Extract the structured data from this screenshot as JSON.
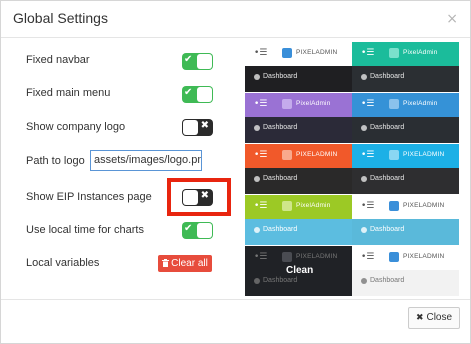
{
  "dialog": {
    "title": "Global Settings",
    "close_glyph": "×"
  },
  "settings": [
    {
      "label": "Fixed navbar",
      "state": "on"
    },
    {
      "label": "Fixed main menu",
      "state": "on"
    },
    {
      "label": "Show company logo",
      "state": "off"
    },
    {
      "label": "Path to logo",
      "value": "assets/images/logo.png"
    },
    {
      "label": "Show EIP Instances page",
      "state": "off",
      "highlighted": true
    },
    {
      "label": "Use local time for charts",
      "state": "on"
    },
    {
      "label": "Local variables",
      "button_label": "Clear all"
    }
  ],
  "toggle_glyphs": {
    "on": "✔",
    "off": "✖"
  },
  "icons": {
    "clear": "trash-icon",
    "close": "close-icon",
    "menu": "menu-icon",
    "dashboard": "dashboard-icon"
  },
  "themes": {
    "menu_glyph": "•☰",
    "dashboard_label": "Dashboard",
    "items": [
      {
        "name": "default",
        "top_bg": "#ffffff",
        "top_fg": "#555555",
        "bot_bg": "#1f1f22",
        "bot_fg": "#e6e6e6",
        "logo_bg": "#3a8fd9",
        "logo_text": "PIXELADMIN"
      },
      {
        "name": "mint",
        "top_bg": "#1bbc9b",
        "top_fg": "#ffffff",
        "bot_bg": "#2b2f33",
        "bot_fg": "#e6e6e6",
        "logo_bg": "#7ae0cc",
        "logo_text": "PixelAdmin"
      },
      {
        "name": "purple",
        "top_bg": "#9a72d4",
        "top_fg": "#ffffff",
        "bot_bg": "#2b2a38",
        "bot_fg": "#e6e6e6",
        "logo_bg": "#c4abec",
        "logo_text": "PixelAdmin"
      },
      {
        "name": "blue",
        "top_bg": "#3592d7",
        "top_fg": "#ffffff",
        "bot_bg": "#2a2e33",
        "bot_fg": "#e6e6e6",
        "logo_bg": "#8bc2ec",
        "logo_text": "PixelAdmin"
      },
      {
        "name": "orange",
        "top_bg": "#f1592a",
        "top_fg": "#ffffff",
        "bot_bg": "#2a2929",
        "bot_fg": "#e6e6e6",
        "logo_bg": "#f9a98d",
        "logo_text": "PIXELADMIN"
      },
      {
        "name": "sky",
        "top_bg": "#1cb0e6",
        "top_fg": "#ffffff",
        "bot_bg": "#2e2e30",
        "bot_fg": "#e6e6e6",
        "logo_bg": "#8ad7f3",
        "logo_text": "PIXELADMIN"
      },
      {
        "name": "lime",
        "top_bg": "#9cc925",
        "top_fg": "#ffffff",
        "bot_bg": "#5cbde0",
        "bot_fg": "#ffffff",
        "logo_bg": "#cfe68a",
        "logo_text": "PixelAdmin"
      },
      {
        "name": "cyan",
        "top_bg": "#ffffff",
        "top_fg": "#555555",
        "bot_bg": "#5ab9da",
        "bot_fg": "#ffffff",
        "logo_bg": "#3a8fd9",
        "logo_text": "PIXELADMIN"
      },
      {
        "name": "clean",
        "top_bg": "#202226",
        "top_fg": "#777777",
        "bot_bg": "#202226",
        "bot_fg": "#777777",
        "logo_bg": "#4a4c52",
        "logo_text": "PIXELADMIN"
      },
      {
        "name": "light",
        "top_bg": "#ffffff",
        "top_fg": "#555555",
        "bot_bg": "#f2f2f2",
        "bot_fg": "#777777",
        "logo_bg": "#3a8fd9",
        "logo_text": "PIXELADMIN"
      }
    ],
    "clean_label": "Clean"
  },
  "footer": {
    "close_label": "Close",
    "close_glyph": "✖"
  }
}
